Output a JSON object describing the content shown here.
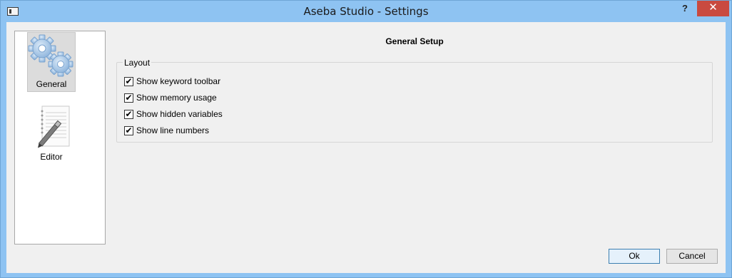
{
  "window": {
    "title": "Aseba Studio - Settings",
    "help_label": "?",
    "close_label": "✕"
  },
  "sidebar": {
    "items": [
      {
        "label": "General",
        "icon": "gears-icon",
        "selected": true
      },
      {
        "label": "Editor",
        "icon": "notepad-pen-icon",
        "selected": false
      }
    ]
  },
  "main": {
    "heading": "General Setup",
    "group": {
      "title": "Layout",
      "options": [
        {
          "label": "Show keyword toolbar",
          "checked": true
        },
        {
          "label": "Show memory usage",
          "checked": true
        },
        {
          "label": "Show hidden variables",
          "checked": true
        },
        {
          "label": "Show line numbers",
          "checked": true
        }
      ]
    }
  },
  "buttons": {
    "ok": "Ok",
    "cancel": "Cancel"
  },
  "colors": {
    "titlebar": "#8ec3f2",
    "close_button": "#c94a40",
    "dialog_bg": "#f0f0f0"
  }
}
